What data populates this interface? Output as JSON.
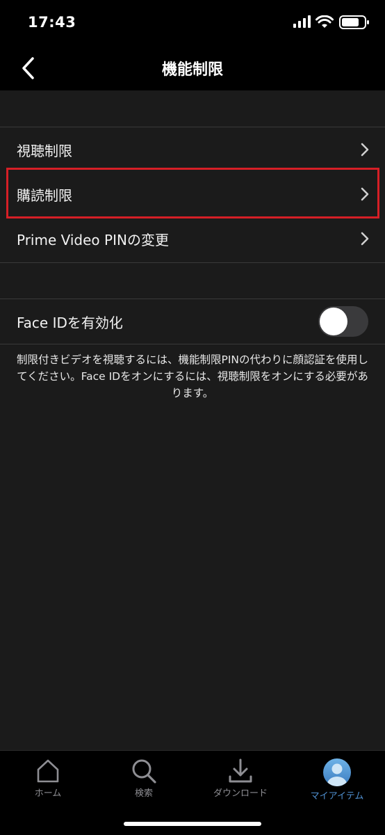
{
  "status_bar": {
    "time": "17:43"
  },
  "nav": {
    "title": "機能制限"
  },
  "restrictions": {
    "items": [
      {
        "label": "視聴制限"
      },
      {
        "label": "購読制限"
      },
      {
        "label": "Prime Video PINの変更"
      }
    ]
  },
  "face_id": {
    "label": "Face IDを有効化",
    "enabled": false,
    "note": "制限付きビデオを視聴するには、機能制限PINの代わりに顔認証を使用してください。Face IDをオンにするには、視聴制限をオンにする必要があります。"
  },
  "tabs": [
    {
      "label": "ホーム",
      "icon": "home-icon",
      "active": false
    },
    {
      "label": "検索",
      "icon": "search-icon",
      "active": false
    },
    {
      "label": "ダウンロード",
      "icon": "download-icon",
      "active": false
    },
    {
      "label": "マイアイテム",
      "icon": "profile-icon",
      "active": true
    }
  ],
  "colors": {
    "background": "#1b1b1b",
    "bar": "#000000",
    "highlight": "#d61f26",
    "active_tab": "#4f8fcf",
    "inactive_tab": "#8e8e93"
  }
}
